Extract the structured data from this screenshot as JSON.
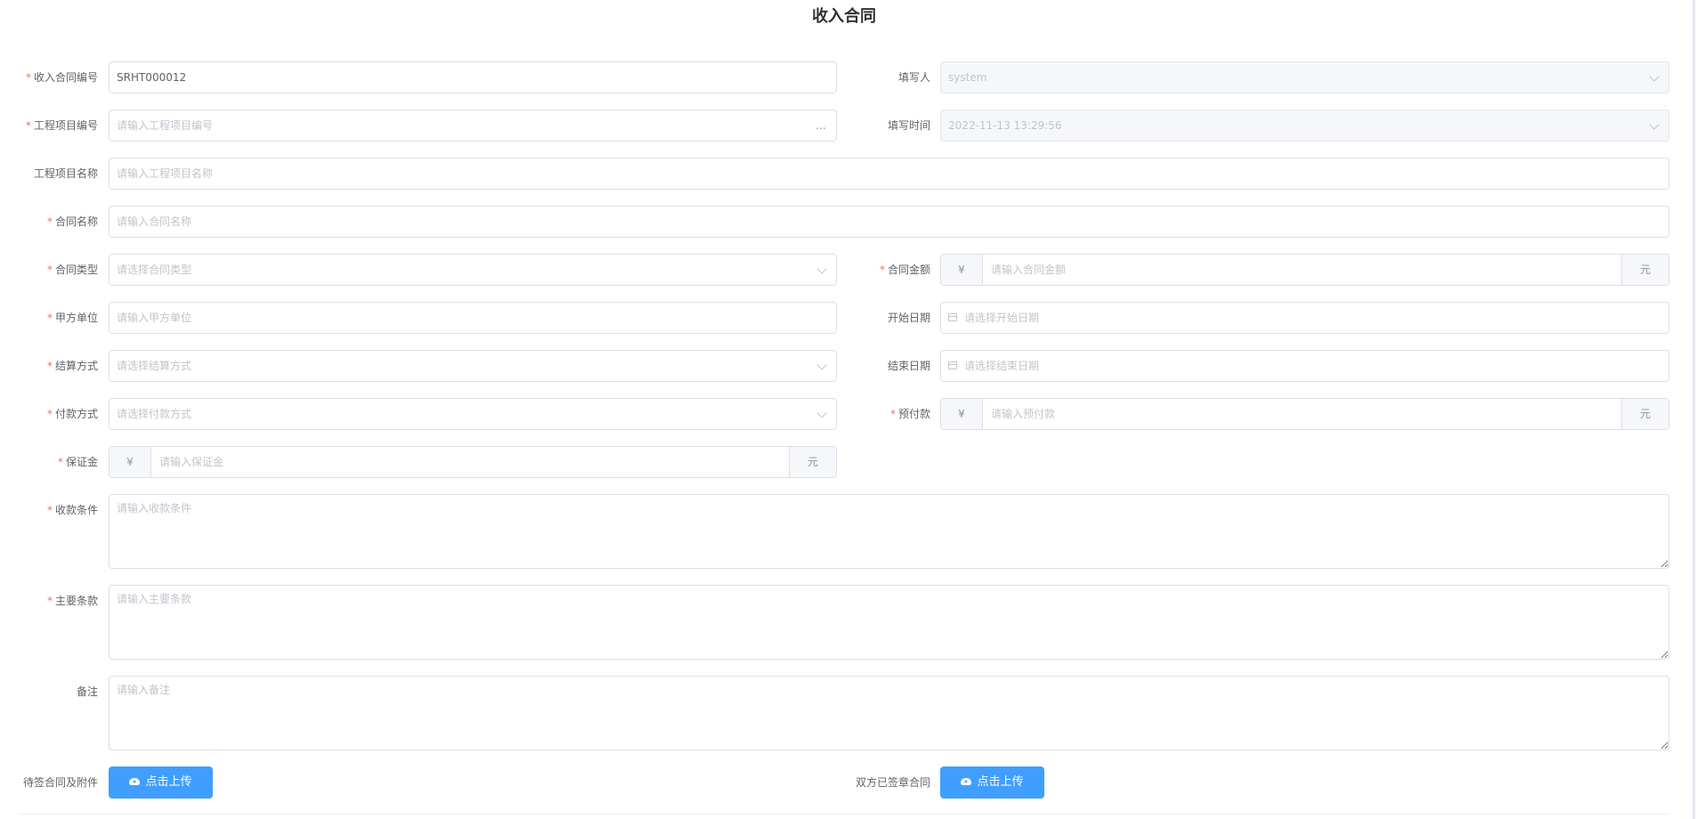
{
  "page": {
    "title": "收入合同"
  },
  "form": {
    "contract_no": {
      "label": "收入合同编号",
      "value": "SRHT000012"
    },
    "filler": {
      "label": "填写人",
      "value": "system"
    },
    "project_no": {
      "label": "工程项目编号",
      "placeholder": "请输入工程项目编号",
      "action_icon": "…"
    },
    "fill_time": {
      "label": "填写时间",
      "value": "2022-11-13 13:29:56"
    },
    "project_name": {
      "label": "工程项目名称",
      "placeholder": "请输入工程项目名称"
    },
    "contract_name": {
      "label": "合同名称",
      "placeholder": "请输入合同名称"
    },
    "contract_type": {
      "label": "合同类型",
      "placeholder": "请选择合同类型"
    },
    "contract_amount": {
      "label": "合同金额",
      "prefix": "¥",
      "placeholder": "请输入合同金额",
      "suffix": "元"
    },
    "party_a": {
      "label": "甲方单位",
      "placeholder": "请输入甲方单位"
    },
    "start_date": {
      "label": "开始日期",
      "placeholder": "请选择开始日期"
    },
    "settlement": {
      "label": "结算方式",
      "placeholder": "请选择结算方式"
    },
    "end_date": {
      "label": "结束日期",
      "placeholder": "请选择结束日期"
    },
    "payment_method": {
      "label": "付款方式",
      "placeholder": "请选择付款方式"
    },
    "advance": {
      "label": "预付款",
      "prefix": "¥",
      "placeholder": "请输入预付款",
      "suffix": "元"
    },
    "deposit": {
      "label": "保证金",
      "prefix": "¥",
      "placeholder": "请输入保证金",
      "suffix": "元"
    },
    "collection_terms": {
      "label": "收款条件",
      "placeholder": "请输入收款条件"
    },
    "main_terms": {
      "label": "主要条款",
      "placeholder": "请输入主要条款"
    },
    "remarks": {
      "label": "备注",
      "placeholder": "请输入备注"
    },
    "attachments": {
      "label": "待签合同及附件",
      "button": "点击上传"
    },
    "signed_contract": {
      "label": "双方已签章合同",
      "button": "点击上传"
    }
  },
  "colors": {
    "primary": "#409eff",
    "required": "#f56c6c",
    "border": "#dcdfe6"
  },
  "icons": {
    "upload": "cloud-upload-icon",
    "select": "chevron-down-icon",
    "date": "calendar-icon",
    "more": "ellipsis-icon"
  }
}
